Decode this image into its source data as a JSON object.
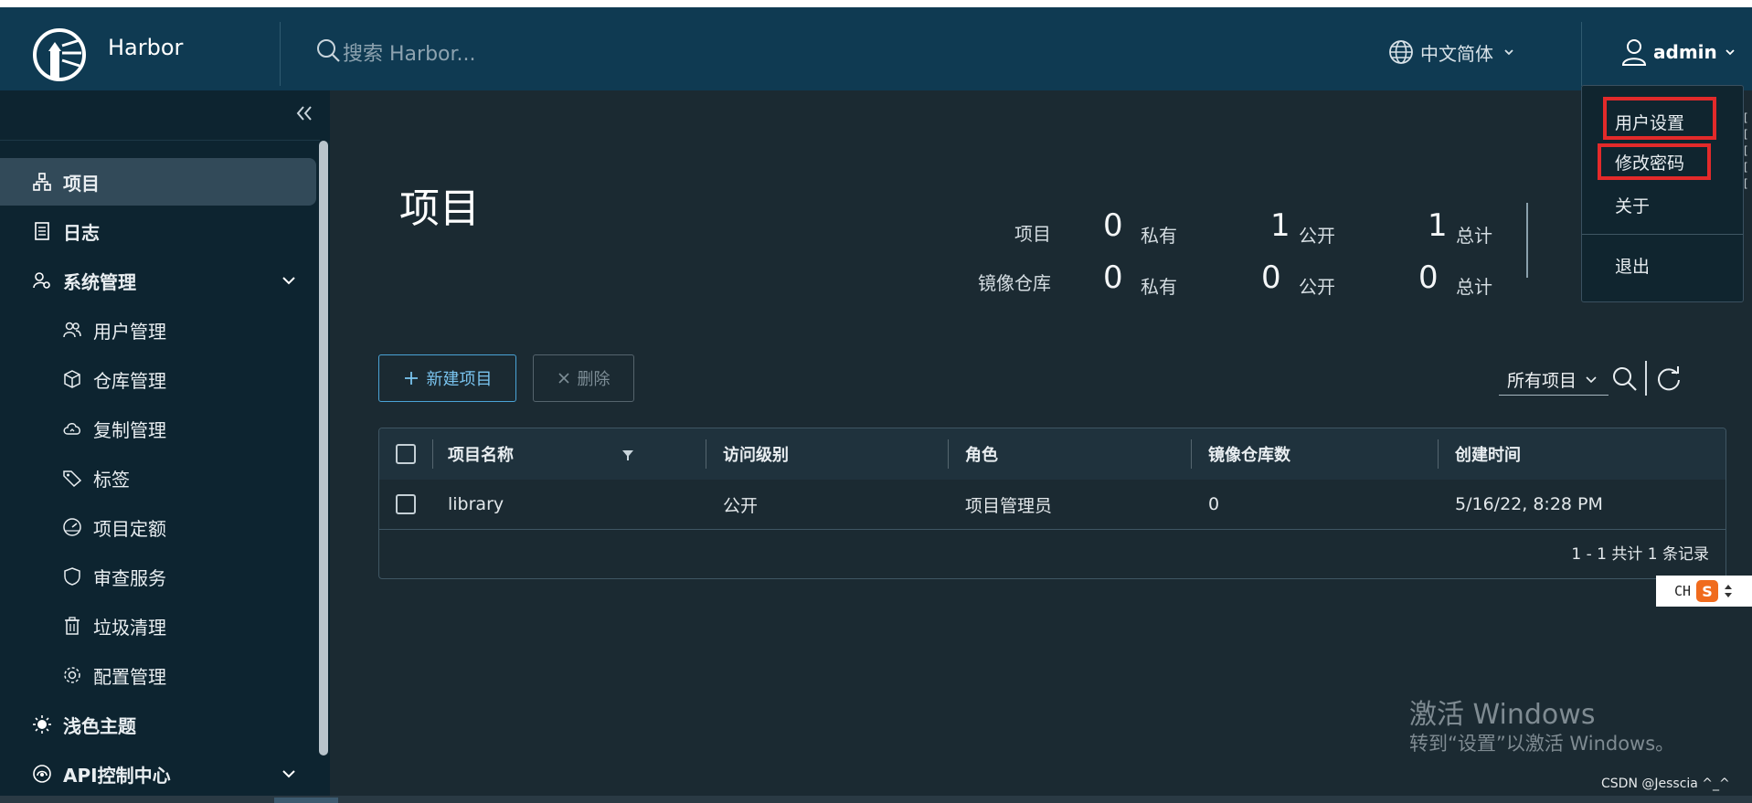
{
  "header": {
    "brand": "Harbor",
    "search_placeholder": "搜索 Harbor...",
    "language": "中文简体",
    "user": "admin"
  },
  "sidebar": {
    "items": [
      {
        "label": "项目"
      },
      {
        "label": "日志"
      },
      {
        "label": "系统管理"
      },
      {
        "label": "用户管理"
      },
      {
        "label": "仓库管理"
      },
      {
        "label": "复制管理"
      },
      {
        "label": "标签"
      },
      {
        "label": "项目定额"
      },
      {
        "label": "审查服务"
      },
      {
        "label": "垃圾清理"
      },
      {
        "label": "配置管理"
      },
      {
        "label": "浅色主题"
      },
      {
        "label": "API控制中心"
      }
    ]
  },
  "main": {
    "title": "项目",
    "stats": {
      "projects_label": "项目",
      "repos_label": "镜像仓库",
      "private_label": "私有",
      "public_label": "公开",
      "total_label": "总计",
      "projects_private": "0",
      "projects_public": "1",
      "projects_total": "1",
      "repos_private": "0",
      "repos_public": "0",
      "repos_total": "0"
    },
    "toolbar": {
      "new_label": "新建项目",
      "delete_label": "删除",
      "filter_value": "所有项目"
    },
    "table": {
      "columns": [
        "项目名称",
        "访问级别",
        "角色",
        "镜像仓库数",
        "创建时间"
      ],
      "rows": [
        {
          "name": "library",
          "access": "公开",
          "role": "项目管理员",
          "repo_count": "0",
          "created": "5/16/22, 8:28 PM"
        }
      ],
      "footer": "1 - 1 共计 1 条记录"
    }
  },
  "user_menu": {
    "items": [
      "用户设置",
      "修改密码",
      "关于",
      "退出"
    ]
  },
  "ime": {
    "label": "CH",
    "brand_glyph": "S"
  },
  "watermark": {
    "title": "激活 Windows",
    "subtitle": "转到“设置”以激活 Windows。",
    "credit": "CSDN @Jesscia ^_^"
  },
  "colors": {
    "header_bg": "#0f3a52",
    "sidebar_bg": "#0d2430",
    "content_bg": "#1b2a32",
    "accent": "#4aa3d6",
    "highlight": "#e32a2a"
  }
}
